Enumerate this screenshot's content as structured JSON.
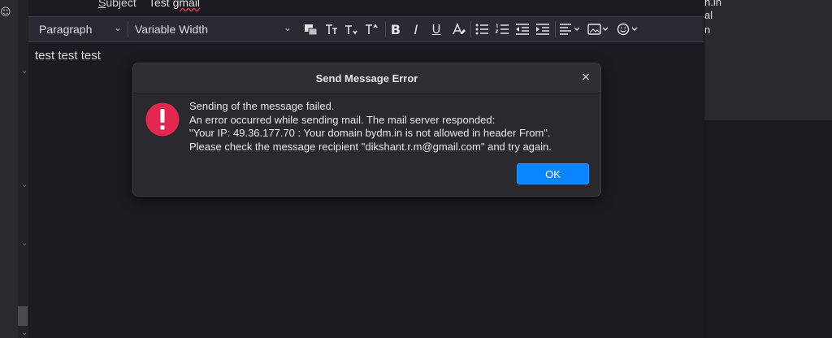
{
  "header": {
    "subject_label_prefix": "S",
    "subject_label_rest": "ubject",
    "subject_value_plain": "Test ",
    "subject_value_misspelled": "gmail"
  },
  "toolbar": {
    "paragraph_format": "Paragraph",
    "font": "Variable Width",
    "icons": [
      "text-color-icon",
      "font-size-smaller-icon",
      "font-size-larger-icon",
      "bold-icon",
      "italic-icon",
      "underline-icon",
      "clear-formatting-icon",
      "bullet-list-icon",
      "numbered-list-icon",
      "outdent-icon",
      "indent-icon",
      "align-icon",
      "insert-image-icon",
      "emoji-icon"
    ],
    "bold_glyph": "B",
    "italic_glyph": "I",
    "underline_glyph": "U"
  },
  "body": {
    "text": "test test test"
  },
  "right_panel": {
    "lines": [
      "n.in",
      "al",
      "n"
    ]
  },
  "dialog": {
    "title": "Send Message Error",
    "close_glyph": "×",
    "lines": [
      "Sending of the message failed.",
      "An error occurred while sending mail. The mail server responded:",
      "\"Your IP: 49.36.177.70 : Your domain bydm.in is not allowed in header From\".",
      "Please check the message recipient \"dikshant.r.m@gmail.com\" and try again."
    ],
    "ok_label": "OK",
    "icon_color": "#e22850"
  }
}
